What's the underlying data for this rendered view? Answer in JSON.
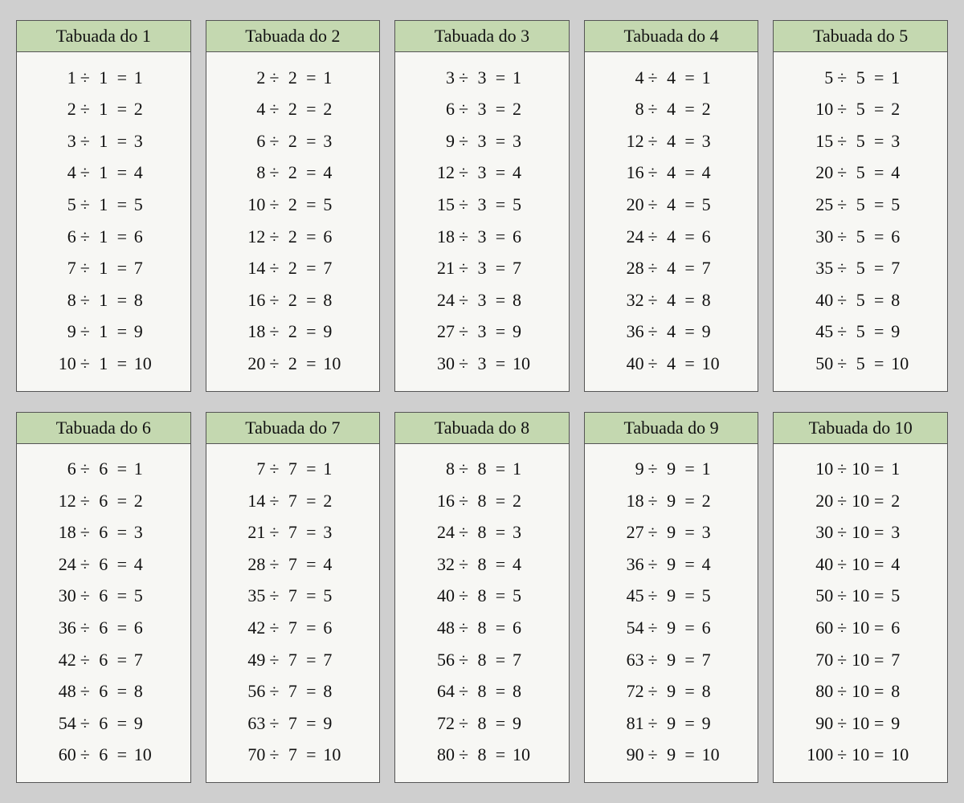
{
  "title_prefix": "Tabuada do",
  "operator": "÷",
  "equals": "=",
  "tables": [
    {
      "n": 1,
      "rows": [
        [
          1,
          1,
          1
        ],
        [
          2,
          1,
          2
        ],
        [
          3,
          1,
          3
        ],
        [
          4,
          1,
          4
        ],
        [
          5,
          1,
          5
        ],
        [
          6,
          1,
          6
        ],
        [
          7,
          1,
          7
        ],
        [
          8,
          1,
          8
        ],
        [
          9,
          1,
          9
        ],
        [
          10,
          1,
          10
        ]
      ]
    },
    {
      "n": 2,
      "rows": [
        [
          2,
          2,
          1
        ],
        [
          4,
          2,
          2
        ],
        [
          6,
          2,
          3
        ],
        [
          8,
          2,
          4
        ],
        [
          10,
          2,
          5
        ],
        [
          12,
          2,
          6
        ],
        [
          14,
          2,
          7
        ],
        [
          16,
          2,
          8
        ],
        [
          18,
          2,
          9
        ],
        [
          20,
          2,
          10
        ]
      ]
    },
    {
      "n": 3,
      "rows": [
        [
          3,
          3,
          1
        ],
        [
          6,
          3,
          2
        ],
        [
          9,
          3,
          3
        ],
        [
          12,
          3,
          4
        ],
        [
          15,
          3,
          5
        ],
        [
          18,
          3,
          6
        ],
        [
          21,
          3,
          7
        ],
        [
          24,
          3,
          8
        ],
        [
          27,
          3,
          9
        ],
        [
          30,
          3,
          10
        ]
      ]
    },
    {
      "n": 4,
      "rows": [
        [
          4,
          4,
          1
        ],
        [
          8,
          4,
          2
        ],
        [
          12,
          4,
          3
        ],
        [
          16,
          4,
          4
        ],
        [
          20,
          4,
          5
        ],
        [
          24,
          4,
          6
        ],
        [
          28,
          4,
          7
        ],
        [
          32,
          4,
          8
        ],
        [
          36,
          4,
          9
        ],
        [
          40,
          4,
          10
        ]
      ]
    },
    {
      "n": 5,
      "rows": [
        [
          5,
          5,
          1
        ],
        [
          10,
          5,
          2
        ],
        [
          15,
          5,
          3
        ],
        [
          20,
          5,
          4
        ],
        [
          25,
          5,
          5
        ],
        [
          30,
          5,
          6
        ],
        [
          35,
          5,
          7
        ],
        [
          40,
          5,
          8
        ],
        [
          45,
          5,
          9
        ],
        [
          50,
          5,
          10
        ]
      ]
    },
    {
      "n": 6,
      "rows": [
        [
          6,
          6,
          1
        ],
        [
          12,
          6,
          2
        ],
        [
          18,
          6,
          3
        ],
        [
          24,
          6,
          4
        ],
        [
          30,
          6,
          5
        ],
        [
          36,
          6,
          6
        ],
        [
          42,
          6,
          7
        ],
        [
          48,
          6,
          8
        ],
        [
          54,
          6,
          9
        ],
        [
          60,
          6,
          10
        ]
      ]
    },
    {
      "n": 7,
      "rows": [
        [
          7,
          7,
          1
        ],
        [
          14,
          7,
          2
        ],
        [
          21,
          7,
          3
        ],
        [
          28,
          7,
          4
        ],
        [
          35,
          7,
          5
        ],
        [
          42,
          7,
          6
        ],
        [
          49,
          7,
          7
        ],
        [
          56,
          7,
          8
        ],
        [
          63,
          7,
          9
        ],
        [
          70,
          7,
          10
        ]
      ]
    },
    {
      "n": 8,
      "rows": [
        [
          8,
          8,
          1
        ],
        [
          16,
          8,
          2
        ],
        [
          24,
          8,
          3
        ],
        [
          32,
          8,
          4
        ],
        [
          40,
          8,
          5
        ],
        [
          48,
          8,
          6
        ],
        [
          56,
          8,
          7
        ],
        [
          64,
          8,
          8
        ],
        [
          72,
          8,
          9
        ],
        [
          80,
          8,
          10
        ]
      ]
    },
    {
      "n": 9,
      "rows": [
        [
          9,
          9,
          1
        ],
        [
          18,
          9,
          2
        ],
        [
          27,
          9,
          3
        ],
        [
          36,
          9,
          4
        ],
        [
          45,
          9,
          5
        ],
        [
          54,
          9,
          6
        ],
        [
          63,
          9,
          7
        ],
        [
          72,
          9,
          8
        ],
        [
          81,
          9,
          9
        ],
        [
          90,
          9,
          10
        ]
      ]
    },
    {
      "n": 10,
      "rows": [
        [
          10,
          10,
          1
        ],
        [
          20,
          10,
          2
        ],
        [
          30,
          10,
          3
        ],
        [
          40,
          10,
          4
        ],
        [
          50,
          10,
          5
        ],
        [
          60,
          10,
          6
        ],
        [
          70,
          10,
          7
        ],
        [
          80,
          10,
          8
        ],
        [
          90,
          10,
          9
        ],
        [
          100,
          10,
          10
        ]
      ]
    }
  ]
}
